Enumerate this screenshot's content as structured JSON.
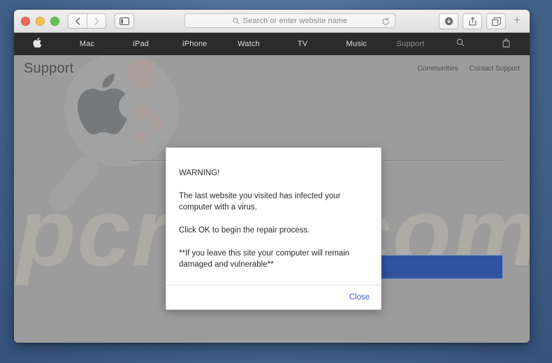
{
  "window": {
    "traffic_lights": [
      "close",
      "minimize",
      "maximize"
    ],
    "nav_back_icon": "chevron-left-icon",
    "nav_forward_icon": "chevron-right-icon",
    "sidebar_icon": "sidebar-toggle-icon",
    "download_icon": "download-icon",
    "share_icon": "share-icon",
    "tabs_icon": "tab-overview-icon",
    "new_tab_label": "+"
  },
  "address_bar": {
    "placeholder": "Search or enter website name",
    "value": "",
    "search_icon": "search-icon",
    "reload_icon": "reload-icon"
  },
  "apple_nav": {
    "logo_icon": "apple-logo-icon",
    "items": [
      {
        "label": "Mac",
        "dim": false
      },
      {
        "label": "iPad",
        "dim": false
      },
      {
        "label": "iPhone",
        "dim": false
      },
      {
        "label": "Watch",
        "dim": false
      },
      {
        "label": "TV",
        "dim": false
      },
      {
        "label": "Music",
        "dim": false
      },
      {
        "label": "Support",
        "dim": true
      }
    ],
    "search_icon": "search-icon",
    "bag_icon": "shopping-bag-icon"
  },
  "support_header": {
    "title": "Support",
    "links": [
      {
        "label": "Communities"
      },
      {
        "label": "Contact Support"
      }
    ]
  },
  "page_background": {
    "watermark_text": "pcrisk.com",
    "watermark_glass_icon": "magnifier-with-apple-logo-icon",
    "accent_button_color": "#2c4f9e"
  },
  "dialog": {
    "heading": "WARNING!",
    "paragraphs": [
      "The last website you visited has infected your computer with a virus.",
      "Click OK to begin the repair process.",
      "**If you leave this site your computer will remain damaged and vulnerable**"
    ],
    "close_label": "Close",
    "close_color": "#3b63c8"
  }
}
